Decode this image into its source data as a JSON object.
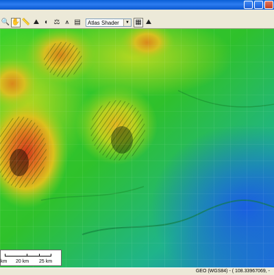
{
  "toolbar": {
    "buttons": [
      {
        "name": "zoom-icon",
        "glyph": "🔍"
      },
      {
        "name": "pan-hand-icon",
        "glyph": "✋"
      },
      {
        "name": "measure-ruler-icon",
        "glyph": "📏"
      },
      {
        "name": "path-profile-icon",
        "glyph": "⛰"
      },
      {
        "name": "light-direction-icon",
        "glyph": "◐"
      },
      {
        "name": "scale-icon",
        "glyph": "⚖"
      },
      {
        "name": "tripod-icon",
        "glyph": "⩚"
      },
      {
        "name": "layers-icon",
        "glyph": "▤"
      }
    ],
    "shader_value": "Atlas Shader",
    "after_buttons": [
      {
        "name": "configure-shader-icon",
        "glyph": "▦"
      },
      {
        "name": "terrain-icon",
        "glyph": "⛰"
      }
    ]
  },
  "scale_bar": {
    "labels": [
      "km",
      "20 km",
      "25 km"
    ]
  },
  "status": {
    "coordinates": "GEO (WGS84) - ( 108.33967069, -"
  },
  "colors": {
    "low_elevation": "#1e6fd9",
    "mid_elevation": "#2fc12b",
    "high_elevation": "#e0b020",
    "peak_elevation": "#d23a1a"
  }
}
